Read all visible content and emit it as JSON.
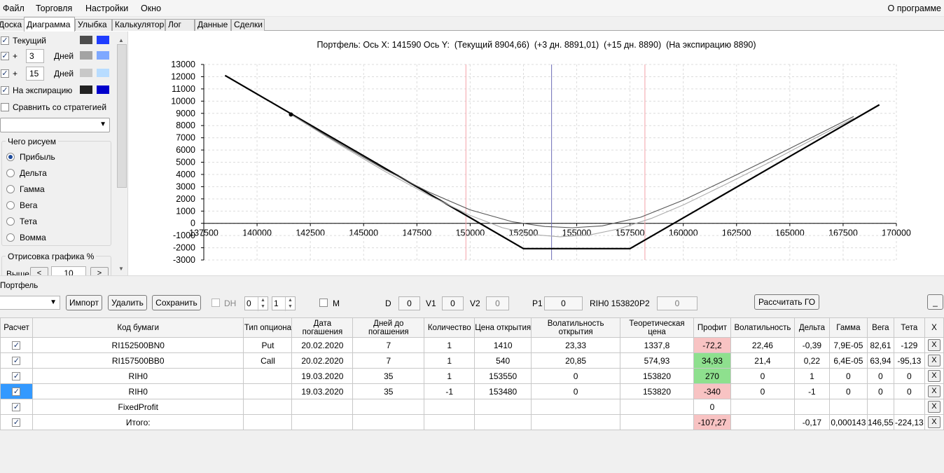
{
  "menu": {
    "items": [
      "Файл",
      "Торговля",
      "Настройки",
      "Окно"
    ],
    "about": "О программе"
  },
  "tabs": [
    "Доска",
    "Диаграмма",
    "Улыбка",
    "Калькулятор",
    "Лог",
    "Данные",
    "Сделки"
  ],
  "active_tab": "Диаграмма",
  "left_panel": {
    "current_label": "Текущий",
    "plus": "+",
    "days_label": "Дней",
    "days_1": "3",
    "days_2": "15",
    "expiration_label": "На экспирацию",
    "compare_label": "Сравнить со стратегией",
    "what_group": "Чего рисуем",
    "options": [
      "Прибыль",
      "Дельта",
      "Гамма",
      "Вега",
      "Тета",
      "Вомма"
    ],
    "selected_option": "Прибыль",
    "draw_group": "Отрисовка графика %",
    "above_label": "Выше",
    "above_value": "10",
    "prev": "<",
    "next": ">",
    "colors": {
      "current": [
        "#4d4d4d",
        "#1f3dff"
      ],
      "d3": [
        "#a3a3a3",
        "#7ea8ff"
      ],
      "d15": [
        "#c8c8c8",
        "#b8dcff"
      ],
      "exp": [
        "#222222",
        "#0000cc"
      ]
    }
  },
  "chart_header": {
    "portfolio": "Портфель:",
    "x_axis_label": "Ось X:",
    "x_value": "141590",
    "y_axis_label": "Ось Y:",
    "current": "(Текущий 8904,66)",
    "d3": "(+3 дн. 8891,01)",
    "d15": "(+15 дн. 8890)",
    "exp": "(На экспирацию 8890)"
  },
  "chart_data": {
    "type": "line",
    "xlim": [
      137500,
      170000
    ],
    "ylim": [
      -3000,
      13000
    ],
    "x_ticks": [
      137500,
      140000,
      142500,
      145000,
      147500,
      150000,
      152500,
      155000,
      157500,
      160000,
      162500,
      165000,
      167500,
      170000
    ],
    "y_ticks": [
      13000,
      12000,
      11000,
      10000,
      9000,
      8000,
      7000,
      6000,
      5000,
      4000,
      3000,
      2000,
      1000,
      0,
      -1000,
      -2000,
      -3000
    ],
    "grid": true,
    "vertical_lines": [
      {
        "x": 149800,
        "color": "#f4a0a8"
      },
      {
        "x": 153820,
        "color": "#6b6bb5"
      },
      {
        "x": 158200,
        "color": "#f4a0a8"
      }
    ],
    "marker": {
      "x": 141590,
      "y": 8904.66
    },
    "series": [
      {
        "color": "#000000",
        "width": 2.2,
        "points": [
          [
            138500,
            12100
          ],
          [
            152500,
            -2070
          ],
          [
            157500,
            -2070
          ],
          [
            169200,
            9700
          ]
        ]
      },
      {
        "color": "#555555",
        "width": 1.1,
        "points": [
          [
            141590,
            8904
          ],
          [
            144000,
            6400
          ],
          [
            146000,
            4400
          ],
          [
            148000,
            2600
          ],
          [
            150000,
            1100
          ],
          [
            152000,
            120
          ],
          [
            153500,
            -260
          ],
          [
            154800,
            -360
          ],
          [
            156200,
            -210
          ],
          [
            158000,
            500
          ],
          [
            160000,
            1900
          ],
          [
            162000,
            3550
          ],
          [
            164000,
            5250
          ],
          [
            166000,
            7000
          ],
          [
            168000,
            8750
          ]
        ]
      },
      {
        "color": "#aaaaaa",
        "width": 1.1,
        "points": [
          [
            141590,
            8891
          ],
          [
            144000,
            6300
          ],
          [
            146000,
            4250
          ],
          [
            148000,
            2350
          ],
          [
            150000,
            650
          ],
          [
            151500,
            -350
          ],
          [
            152800,
            -900
          ],
          [
            154200,
            -1100
          ],
          [
            155600,
            -950
          ],
          [
            157000,
            -450
          ],
          [
            158500,
            400
          ],
          [
            160000,
            1500
          ],
          [
            162000,
            3200
          ],
          [
            164000,
            4950
          ],
          [
            166000,
            6800
          ],
          [
            168000,
            8600
          ]
        ]
      }
    ]
  },
  "portfolio": {
    "title": "Портфель",
    "combo_value": "",
    "import": "Импорт",
    "delete": "Удалить",
    "save": "Сохранить",
    "dh_label": "DH",
    "dh_value": "0",
    "step_value": "1",
    "m_label": "M",
    "d_label": "D",
    "d_value": "0",
    "v1_label": "V1",
    "v1_value": "0",
    "v2_label": "V2",
    "v2_value": "0",
    "p1_label": "P1",
    "p1_value": "0",
    "rih_label": "RIH0 153820",
    "p2_label": "P2",
    "p2_value": "0",
    "calc_go": "Рассчитать ГО",
    "minimize": "_"
  },
  "grid": {
    "columns": [
      "Расчет",
      "Код бумаги",
      "Тип опциона",
      "Дата погашения",
      "Дней до погашения",
      "Количество",
      "Цена открытия",
      "Волатильность открытия",
      "Теоретическая цена",
      "Профит",
      "Волатильность",
      "Дельта",
      "Гамма",
      "Вега",
      "Тета",
      "X"
    ],
    "rows": [
      [
        "RI152500BN0",
        "Put",
        "20.02.2020",
        "7",
        "1",
        "1410",
        "23,33",
        "1337,8",
        "-72,2",
        "22,46",
        "-0,39",
        "7,9E-05",
        "82,61",
        "-129"
      ],
      [
        "RI157500BB0",
        "Call",
        "20.02.2020",
        "7",
        "1",
        "540",
        "20,85",
        "574,93",
        "34,93",
        "21,4",
        "0,22",
        "6,4E-05",
        "63,94",
        "-95,13"
      ],
      [
        "RIH0",
        "",
        "19.03.2020",
        "35",
        "1",
        "153550",
        "0",
        "153820",
        "270",
        "0",
        "1",
        "0",
        "0",
        "0"
      ],
      [
        "RIH0",
        "",
        "19.03.2020",
        "35",
        "-1",
        "153480",
        "0",
        "153820",
        "-340",
        "0",
        "-1",
        "0",
        "0",
        "0"
      ],
      [
        "FixedProfit",
        "",
        "",
        "",
        "",
        "",
        "",
        "",
        "0",
        "",
        "",
        "",
        "",
        ""
      ],
      [
        "Итого:",
        "",
        "",
        "",
        "",
        "",
        "",
        "",
        "-107,27",
        "",
        "-0,17",
        "0,000143",
        "146,55",
        "-224,13"
      ]
    ],
    "profit_colors": [
      "red",
      "green",
      "green",
      "red",
      "none",
      "red"
    ],
    "x_label": "X"
  }
}
